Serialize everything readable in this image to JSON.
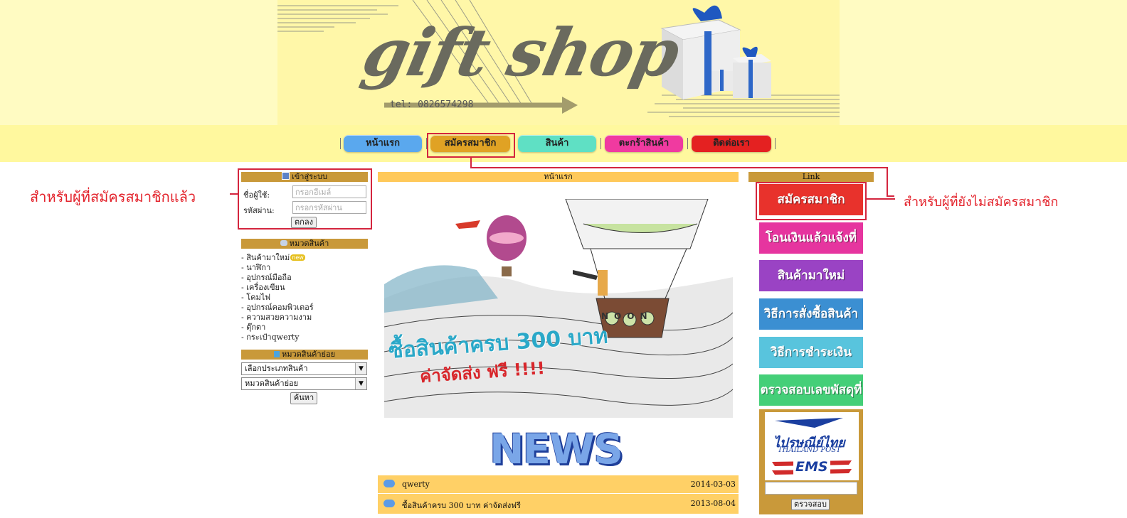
{
  "header": {
    "logo_text": "gift shop",
    "tel": "tel: 0826574298"
  },
  "nav": {
    "items": [
      {
        "label": "หน้าแรก",
        "color": "#5aa8ee"
      },
      {
        "label": "สมัครสมาชิก",
        "color": "#e0a224"
      },
      {
        "label": "สินค้า",
        "color": "#5fe0c4"
      },
      {
        "label": "ตะกร้าสินค้า",
        "color": "#f03aa0"
      },
      {
        "label": "ติดต่อเรา",
        "color": "#e42121"
      }
    ]
  },
  "annotations": {
    "left": "สำหรับผู้ที่สมัครสมาชิกแล้ว",
    "right": "สำหรับผู้ที่ยังไม่สมัครสมาชิก"
  },
  "login": {
    "title": "เข้าสู่ระบบ",
    "username_label": "ชื่อผู้ใช้:",
    "username_placeholder": "กรอกอีเมล์",
    "password_label": "รหัสผ่าน:",
    "password_placeholder": "กรอกรหัสผ่าน",
    "submit": "ตกลง"
  },
  "categories": {
    "title": "หมวดสินค้า",
    "new_badge": "new",
    "items": [
      "- สินค้ามาใหม่",
      "- นาฬิกา",
      "- อุปกรณ์มือถือ",
      "- เครื่องเขียน",
      "- โคมไฟ",
      "- อุปกรณ์คอมพิวเตอร์",
      "- ความสวยความงาม",
      "- ตุ๊กตา",
      "- กระเป๋าqwerty"
    ]
  },
  "subcategories": {
    "title": "หมวดสินค้าย่อย",
    "type_select": "เลือกประเภทสินค้า",
    "sub_select": "หมวดสินค้าย่อย",
    "search": "ค้นหา"
  },
  "main": {
    "title": "หน้าแรก",
    "banner_line1": "ซื้อสินค้าครบ 300 บาท",
    "banner_line2": "ค่าจัดส่ง ฟรี !!!!",
    "balloon_text": "NOON",
    "news_heading": "NEWS",
    "news": [
      {
        "title": "qwerty",
        "date": "2014-03-03"
      },
      {
        "title": "ซื้อสินค้าครบ 300 บาท ค่าจัดส่งฟรี",
        "date": "2013-08-04"
      }
    ]
  },
  "links": {
    "title": "Link",
    "buttons": [
      {
        "label": "สมัครสมาชิก",
        "color": "#e8322c"
      },
      {
        "label": "โอนเงินแล้วแจ้งที่นี่!!",
        "color": "#e6359f"
      },
      {
        "label": "สินค้ามาใหม่",
        "color": "#9a43c4"
      },
      {
        "label": "วิธีการสั่งซื้อสินค้า",
        "color": "#3b8fd2"
      },
      {
        "label": "วิธีการชำระเงิน",
        "color": "#58c4dd"
      },
      {
        "label": "ตรวจสอบเลขพัสดุที่นี่",
        "color": "#44cf78"
      }
    ],
    "post_th": "ไปรษณีย์ไทย",
    "post_en": "THAILAND POST",
    "ems": "EMS",
    "check_button": "ตรวจสอบ"
  }
}
